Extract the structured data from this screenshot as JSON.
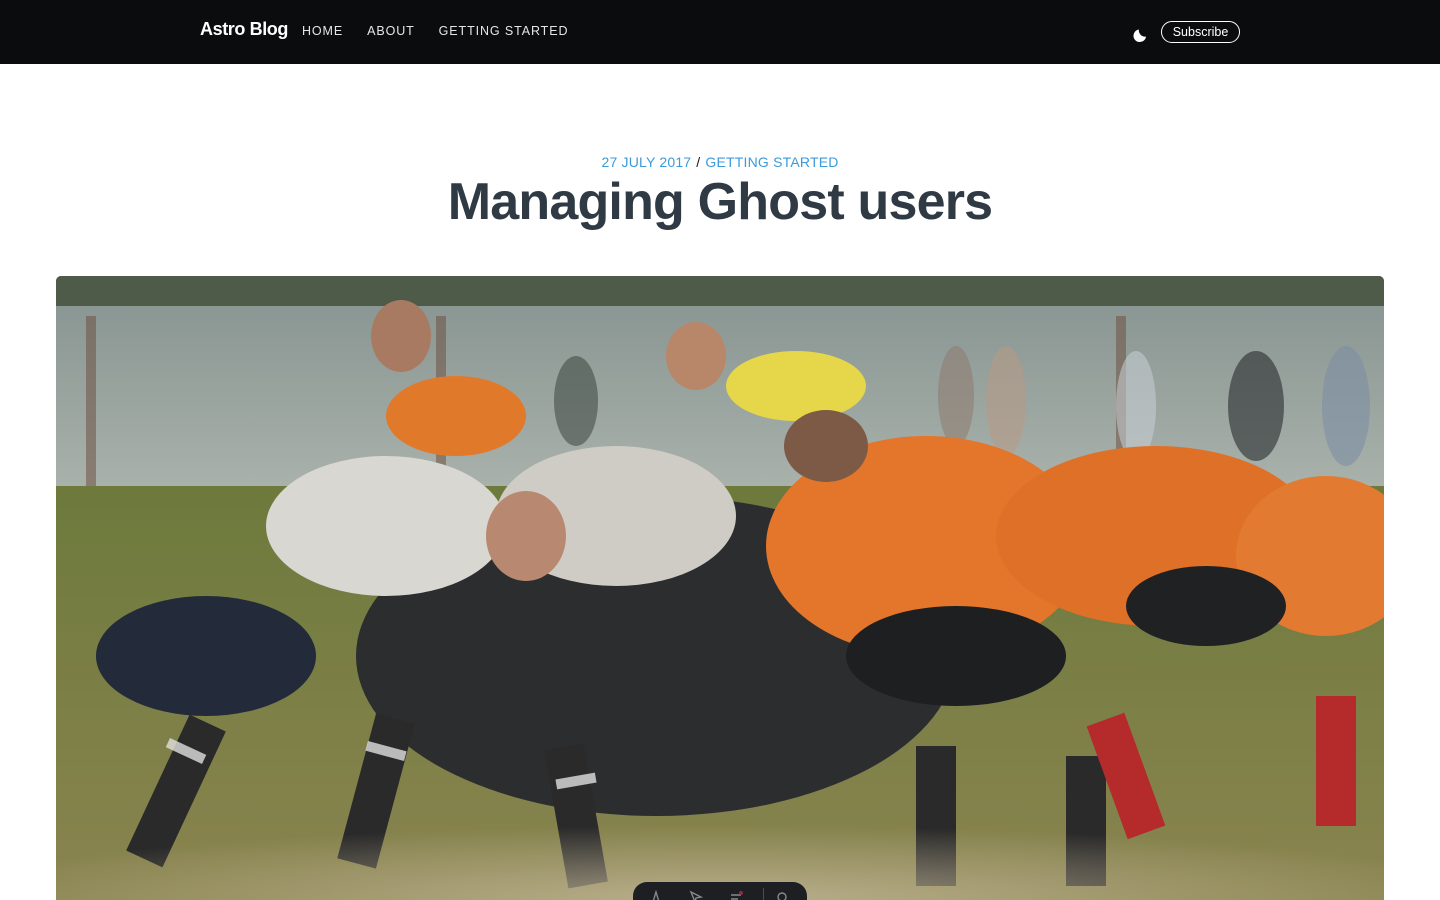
{
  "header": {
    "brand": "Astro Blog",
    "nav": [
      {
        "label": "HOME"
      },
      {
        "label": "ABOUT"
      },
      {
        "label": "GETTING STARTED"
      }
    ],
    "theme_toggle_icon": "moon-icon",
    "subscribe_label": "Subscribe"
  },
  "post": {
    "date": "27 JULY 2017",
    "separator": "/",
    "category": "GETTING STARTED",
    "title": "Managing Ghost users",
    "feature_image_alt": "rugby-scrum-photo"
  },
  "toolbar": {
    "icons": [
      "astro-icon",
      "inspect-icon",
      "audit-icon",
      "settings-icon"
    ]
  },
  "colors": {
    "header_bg": "#0b0c0e",
    "accent": "#3b9ad9",
    "title": "#2f3a44"
  }
}
